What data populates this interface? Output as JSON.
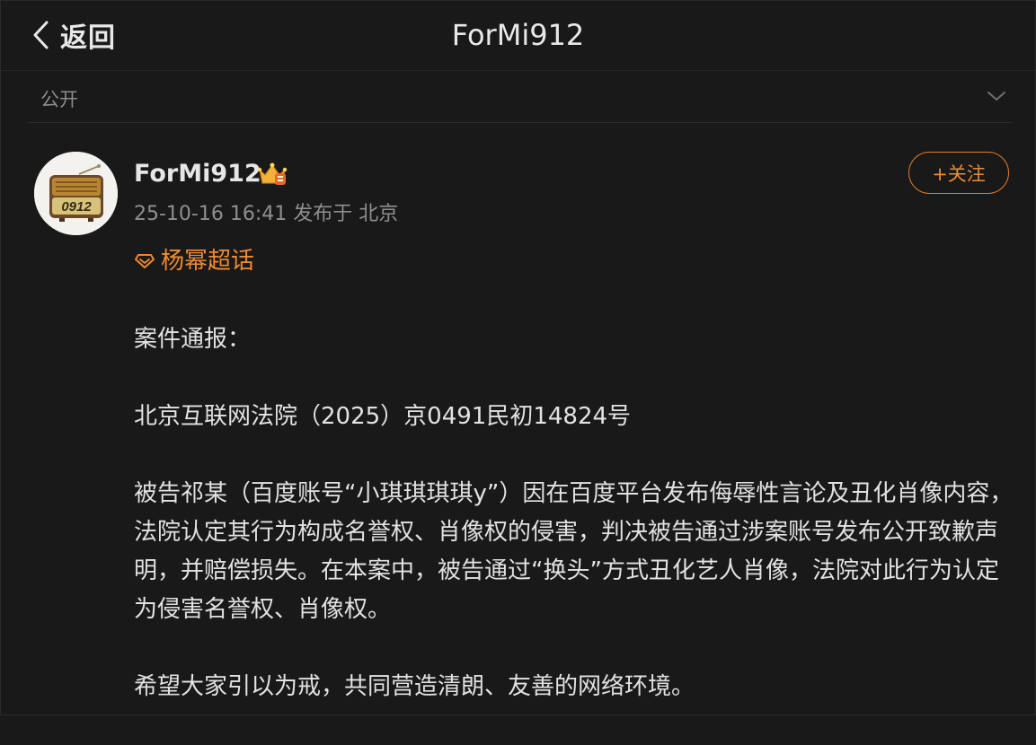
{
  "header": {
    "back_label": "返回",
    "title": "ForMi912"
  },
  "visibility": {
    "label": "公开"
  },
  "post": {
    "author": "ForMi912",
    "avatar_text": "0912",
    "meta": "25-10-16 16:41 发布于 北京",
    "follow_label": "+关注",
    "topic": "杨幂超话",
    "paragraphs": [
      "案件通报：",
      "北京互联网法院（2025）京0491民初14824号",
      "被告祁某（百度账号“小琪琪琪琪y”）因在百度平台发布侮辱性言论及丑化肖像内容，法院认定其行为构成名誉权、肖像权的侵害，判决被告通过涉案账号发布公开致歉声明，并赔偿损失。在本案中，被告通过“换头”方式丑化艺人肖像，法院对此行为认定为侵害名誉权、肖像权。",
      "希望大家引以为戒，共同营造清朗、友善的网络环境。"
    ]
  },
  "colors": {
    "background": "#191919",
    "accent": "#ef8a32",
    "text": "#e2e2e2",
    "muted": "#8f8f8f"
  },
  "icons": {
    "back": "chevron-left-icon",
    "visibility": "chevron-down-icon",
    "badge": "crown-badge-icon",
    "topic": "diamond-icon"
  }
}
